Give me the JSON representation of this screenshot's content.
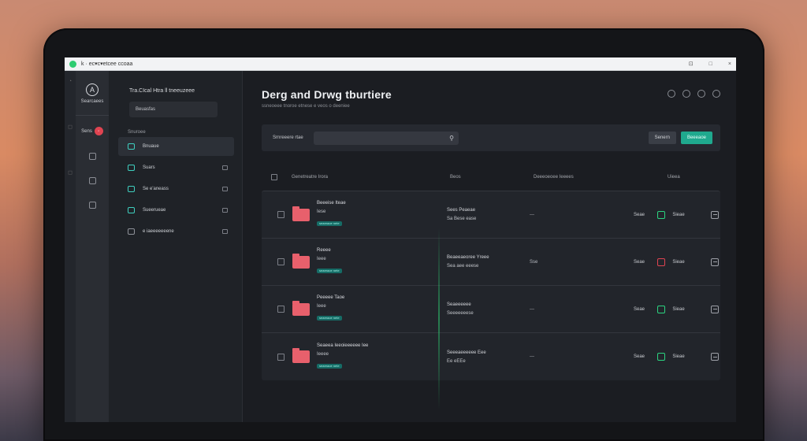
{
  "browser": {
    "url": "k · ec▾c▾etcee ccoaa",
    "controls": [
      "⊡",
      "□",
      "×"
    ]
  },
  "rail": {
    "icons": [
      "◔",
      "◻",
      "◻"
    ]
  },
  "nav": {
    "logo_label": "Searcaees",
    "item_label": "Sens",
    "badge": "◦"
  },
  "sidebar": {
    "title": "Tra.CIcal Htra ll tneeuzeee",
    "button": "Beuasfas",
    "section": "Snuroee",
    "items": [
      {
        "label": "Bnuaue",
        "active": true
      },
      {
        "label": "Suars",
        "active": false
      },
      {
        "label": "Se e'aneass",
        "active": false
      },
      {
        "label": "Sueerueae",
        "active": false
      },
      {
        "label": "e iaeeeeeeene",
        "active": false
      }
    ]
  },
  "main": {
    "title": "Derg and Drwg tburtiere",
    "subtitle": "ssneoeee tnoroe etnese e veos o deeniee",
    "filter_label": "Srnreeere rtae",
    "search_icon": "magnifier-icon",
    "btn_secondary": "Senern",
    "btn_primary": "Beeeaoe",
    "columns": {
      "name": "Genetreatre Irora",
      "owner": "Beos",
      "modified": "Deeeoeoee Ieeees",
      "visibility": "Uieea"
    },
    "rows": [
      {
        "name": "Beeeise Iteae",
        "sub": "Iese",
        "tag": "seareaoe nete",
        "owner": "Sees Peaeae",
        "owner_sub": "Sa Bese ease",
        "modified": "---",
        "size": "Seae",
        "status": "ok",
        "vis": "Sieae"
      },
      {
        "name": "Reeee",
        "sub": "Ieee",
        "tag": "seareaoe nete",
        "owner": "Beaeeaeoree Yreee",
        "owner_sub": "Sea aee eeese",
        "modified": "Sse",
        "size": "Seae",
        "status": "warn",
        "vis": "Sieae"
      },
      {
        "name": "Peeeee Taoe",
        "sub": "Ieee",
        "tag": "seareaoe nete",
        "owner": "Seaeeeeee",
        "owner_sub": "Seeeeeeese",
        "modified": "---",
        "size": "Seae",
        "status": "ok",
        "vis": "Sieae"
      },
      {
        "name": "Seaeea Ieeoieeeeee Iee",
        "sub": "Ieeee",
        "tag": "seareaoe nete",
        "owner": "Seeeaeeeeee Eee",
        "owner_sub": "Ee eEEe",
        "modified": "---",
        "size": "Seae",
        "status": "ok",
        "vis": "Sieae"
      }
    ]
  }
}
